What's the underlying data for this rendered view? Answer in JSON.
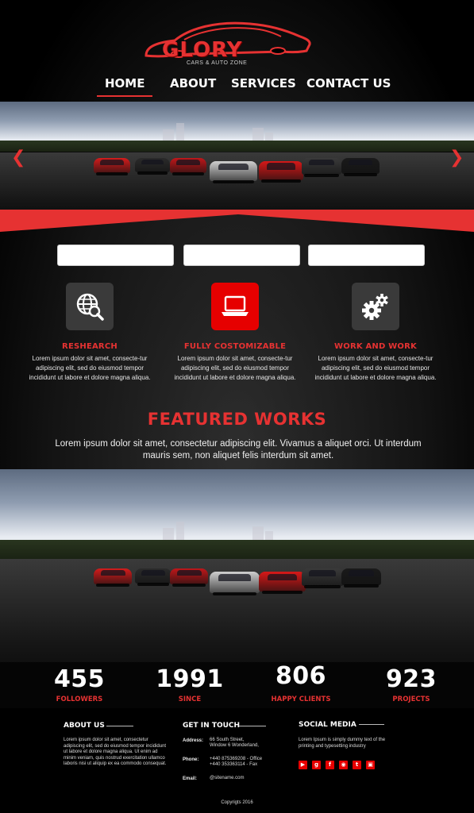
{
  "brand": {
    "name": "GLORY",
    "tagline": "CARS & AUTO ZONE",
    "accent": "#e63232"
  },
  "nav": {
    "items": [
      {
        "label": "HOME",
        "active": true
      },
      {
        "label": "ABOUT",
        "active": false
      },
      {
        "label": "SERVICES",
        "active": false
      },
      {
        "label": "CONTACT US",
        "active": false
      }
    ]
  },
  "slider": {
    "prev_icon": "chevron-left-icon",
    "next_icon": "chevron-right-icon"
  },
  "search_boxes": [
    {
      "value": ""
    },
    {
      "value": ""
    },
    {
      "value": ""
    }
  ],
  "features": [
    {
      "icon": "globe-search-icon",
      "title": "RESHEARCH",
      "text": "Lorem ipsum dolor sit amet, consecte-tur adipiscing elit, sed do eiusmod tempor incididunt ut labore et dolore magna aliqua."
    },
    {
      "icon": "laptop-icon",
      "title": "FULLY COSTOMIZABLE",
      "text": "Lorem ipsum dolor sit amet, consecte-tur adipiscing elit, sed do eiusmod tempor incididunt ut labore et dolore magna aliqua."
    },
    {
      "icon": "gears-icon",
      "title": "WORK AND WORK",
      "text": "Lorem ipsum dolor sit amet, consecte-tur adipiscing elit, sed do eiusmod tempor incididunt ut labore et dolore magna aliqua."
    }
  ],
  "featured": {
    "title": "FEATURED WORKS",
    "text": "Lorem ipsum dolor sit amet, consectetur adipiscing elit. Vivamus a aliquet orci. Ut interdum mauris sem, non aliquet felis interdum sit amet."
  },
  "stats": [
    {
      "number": "455",
      "label": "FOLLOWERS"
    },
    {
      "number": "1991",
      "label": "SINCE"
    },
    {
      "number": "806",
      "label": "HAPPY CLIENTS"
    },
    {
      "number": "923",
      "label": "PROJECTS"
    }
  ],
  "footer": {
    "about": {
      "heading": "ABOUT US",
      "text": "Lorem ipsum dolor sit amet, consectetur adipiscing elit, sed do eiusmod tempor incididunt ut labore et dolore magna aliqua. Ut enim ad minim veniam, quis nostrud exercitation ullamco laboris nisi ut aliquip ex ea commodo consequat."
    },
    "contact": {
      "heading": "GET IN TOUCH",
      "address_label": "Address:",
      "address_line1": "66 South Street,",
      "address_line2": "Window 6 Wonderland,",
      "phone_label": "Phone:",
      "phone_line1": "+440 875369208 - Office",
      "phone_line2": "+440 353363114 - Fax",
      "email_label": "Email:",
      "email_value": "@sitename.com"
    },
    "social": {
      "heading": "SOCIAL MEDIA",
      "text": "Lorem Ipsum is simply dummy text of the printing and typesetting industry",
      "icons": [
        "youtube-icon",
        "google-plus-icon",
        "facebook-icon",
        "dribbble-icon",
        "twitter-icon",
        "instagram-icon"
      ]
    },
    "copyright": "Copyrigts 2016"
  }
}
